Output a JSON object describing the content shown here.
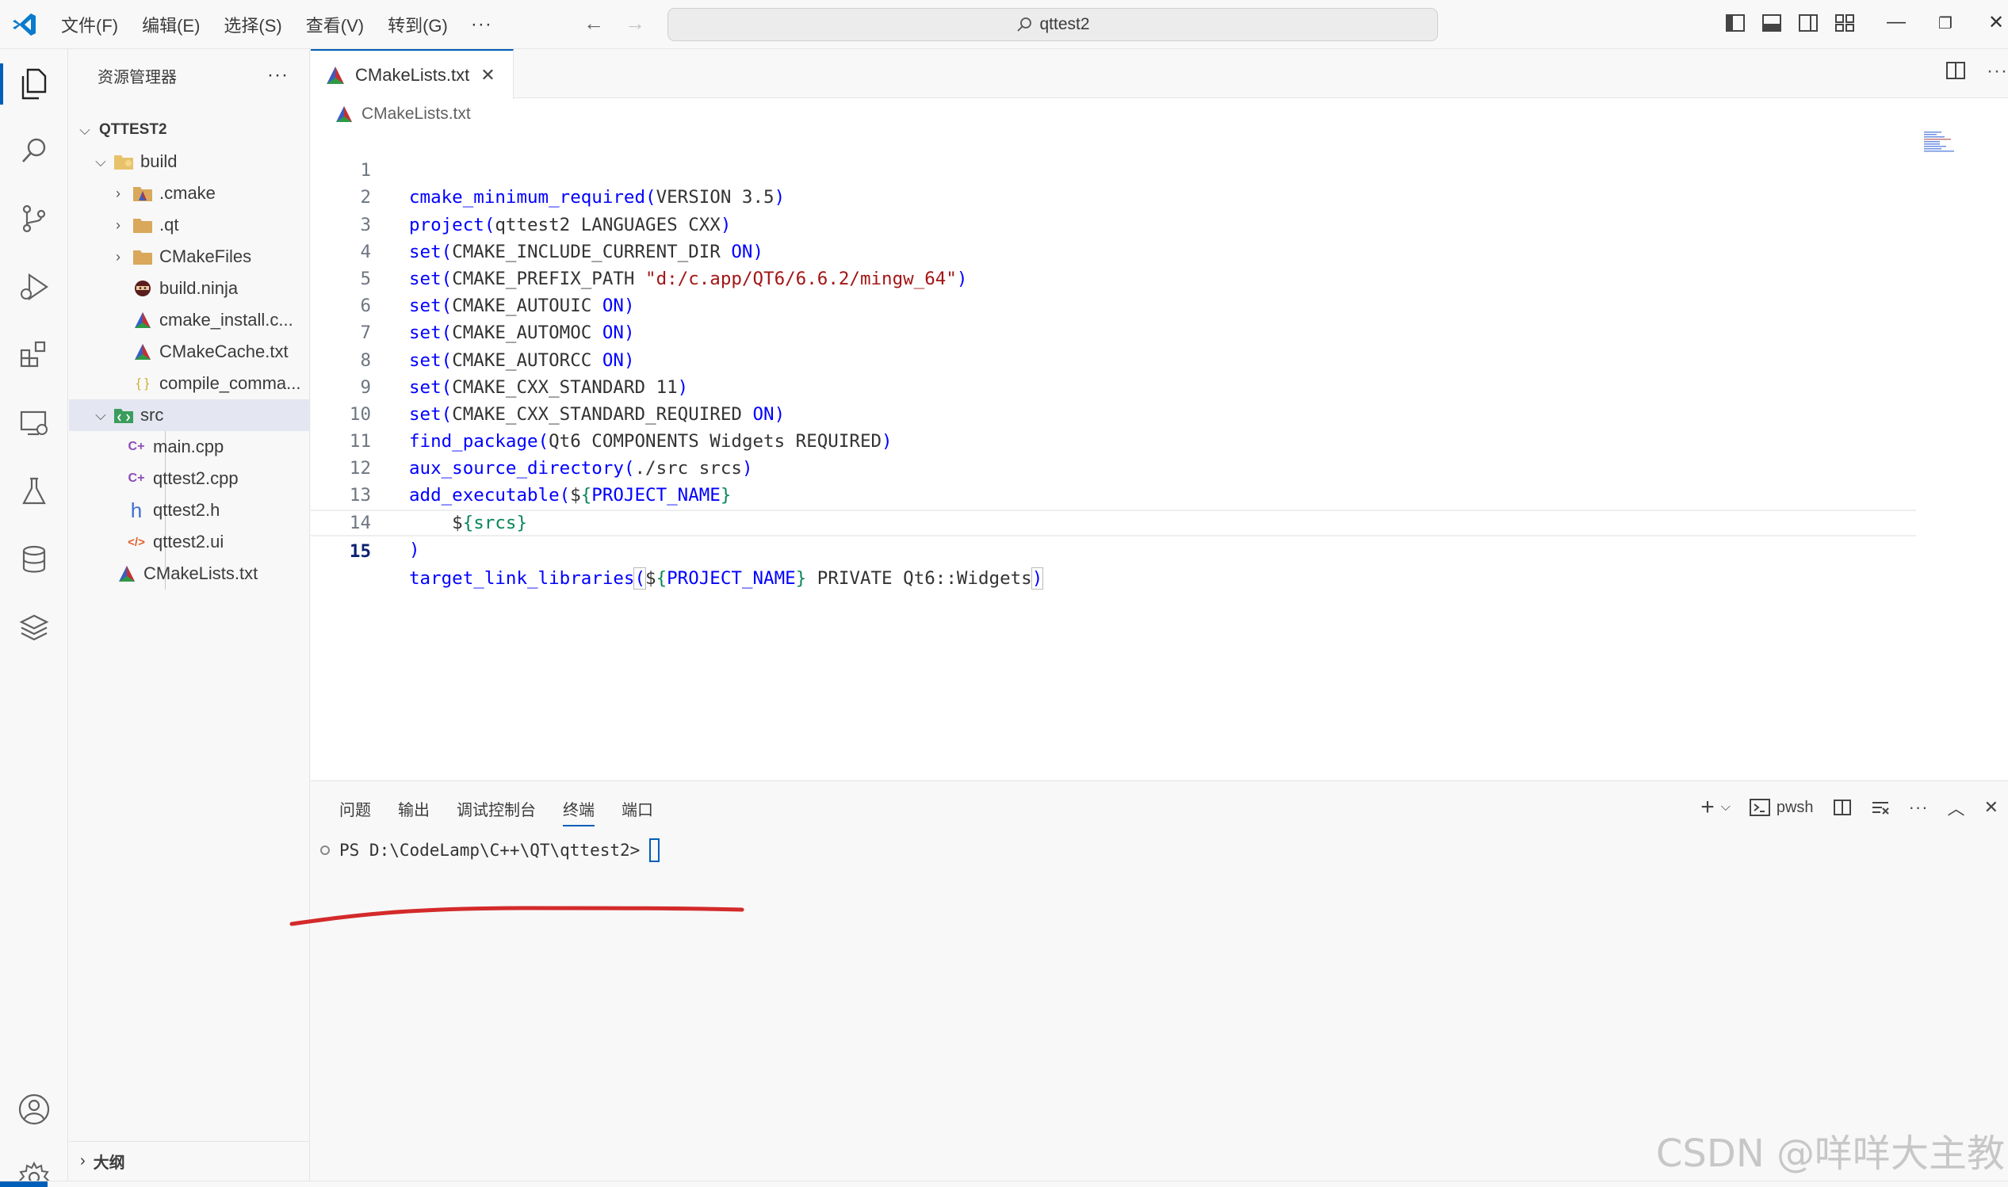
{
  "titlebar": {
    "menu": [
      "文件(F)",
      "编辑(E)",
      "选择(S)",
      "查看(V)",
      "转到(G)"
    ],
    "menu_more": "···",
    "search": "qttest2"
  },
  "sidebar": {
    "title": "资源管理器",
    "more": "···",
    "root": "QTTEST2",
    "items": [
      {
        "label": "build",
        "icon": "folder-build-icon"
      },
      {
        "label": ".cmake",
        "icon": "folder-cmake-icon"
      },
      {
        "label": ".qt",
        "icon": "folder-icon"
      },
      {
        "label": "CMakeFiles",
        "icon": "folder-icon"
      },
      {
        "label": "build.ninja",
        "icon": "ninja-icon"
      },
      {
        "label": "cmake_install.c...",
        "icon": "cmake-icon"
      },
      {
        "label": "CMakeCache.txt",
        "icon": "cmake-icon"
      },
      {
        "label": "compile_comma...",
        "icon": "json-icon"
      },
      {
        "label": "src",
        "icon": "folder-src-icon"
      },
      {
        "label": "main.cpp",
        "icon": "cpp-icon"
      },
      {
        "label": "qttest2.cpp",
        "icon": "cpp-icon"
      },
      {
        "label": "qttest2.h",
        "icon": "header-icon"
      },
      {
        "label": "qttest2.ui",
        "icon": "xml-icon"
      },
      {
        "label": "CMakeLists.txt",
        "icon": "cmake-icon"
      }
    ],
    "outline": "大纲"
  },
  "editor": {
    "tab_label": "CMakeLists.txt",
    "breadcrumb": "CMakeLists.txt",
    "line_numbers": [
      "1",
      "2",
      "3",
      "4",
      "5",
      "6",
      "7",
      "8",
      "9",
      "10",
      "11",
      "12",
      "13",
      "14",
      "15"
    ],
    "current_line": 15
  },
  "panel": {
    "tabs": [
      "问题",
      "输出",
      "调试控制台",
      "终端",
      "端口"
    ],
    "active_tab": "终端",
    "shell": "pwsh",
    "prompt": "PS D:\\CodeLamp\\C++\\QT\\qttest2>"
  },
  "watermark": "CSDN @咩咩大主教",
  "colors": {
    "accent": "#005fb8",
    "keyword": "#0000ff",
    "string": "#a31515",
    "annotation_stroke": "#d42a2a"
  }
}
